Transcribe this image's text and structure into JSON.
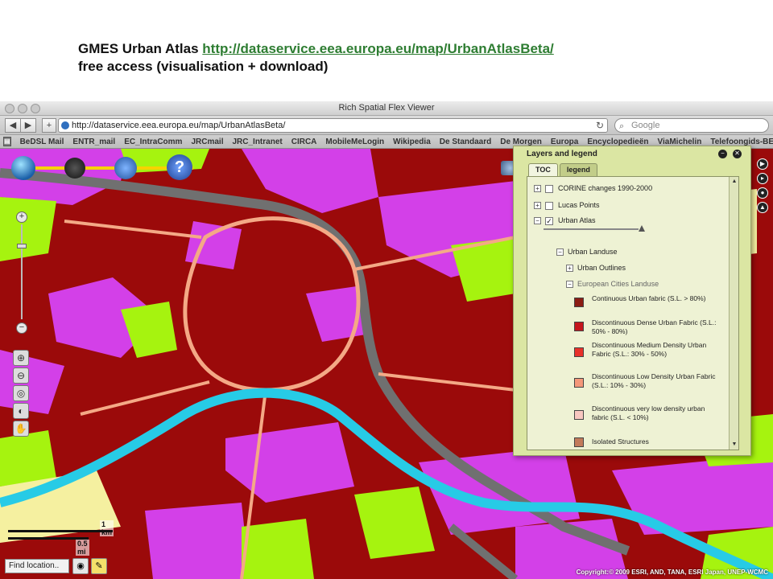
{
  "slide": {
    "title_text": "GMES Urban Atlas ",
    "link": "http://dataservice.eea.europa.eu/map/UrbanAtlasBeta/",
    "subtitle": "free access (visualisation + download)"
  },
  "browser": {
    "window_title": "Rich Spatial Flex Viewer",
    "url": "http://dataservice.eea.europa.eu/map/UrbanAtlasBeta/",
    "search_placeholder": "Google",
    "bookmarks": [
      "BeDSL Mail",
      "ENTR_mail",
      "EC_IntraComm",
      "JRCmail",
      "JRC_Intranet",
      "CIRCA",
      "MobileMeLogin",
      "Wikipedia",
      "De Standaard",
      "De Morgen",
      "Europa",
      "Encyclopedieën",
      "ViaMichelin",
      "Telefoongids-BE"
    ]
  },
  "map": {
    "scale_km": "1 km",
    "scale_mi": "0.5 mi",
    "find_placeholder": "Find location..",
    "copyright": "Copyright:© 2009 ESRI, AND, TANA, ESRI Japan, UNEP-WCMC",
    "colors": {
      "urban": "#9b0a0a",
      "green": "#a6f30f",
      "purple": "#d340e8",
      "river": "#27cbe6",
      "road": "#f4a986",
      "motorway": "#707070"
    }
  },
  "legend": {
    "title": "Layers and legend",
    "tabs": [
      "TOC",
      "legend"
    ],
    "layers": {
      "corine": "CORINE changes 1990-2000",
      "lucas": "Lucas Points",
      "urban_atlas": "Urban Atlas",
      "urban_landuse": "Urban Landuse",
      "urban_outlines": "Urban Outlines",
      "european_cities": "European Cities Landuse"
    },
    "items": [
      {
        "label": "Continuous Urban fabric (S.L. > 80%)",
        "color": "#8c1d14"
      },
      {
        "label": "Discontinuous Dense Urban Fabric (S.L.: 50% - 80%)",
        "color": "#c4161c"
      },
      {
        "label": "Discontinuous Medium Density Urban Fabric (S.L.: 30% - 50%)",
        "color": "#e8312a"
      },
      {
        "label": "Discontinuous Low Density Urban Fabric (S.L.: 10% - 30%)",
        "color": "#f4987a"
      },
      {
        "label": "Discontinuous very low density urban fabric (S.L. < 10%)",
        "color": "#f8c7c0"
      },
      {
        "label": "Isolated Structures",
        "color": "#c27a5a"
      }
    ]
  }
}
